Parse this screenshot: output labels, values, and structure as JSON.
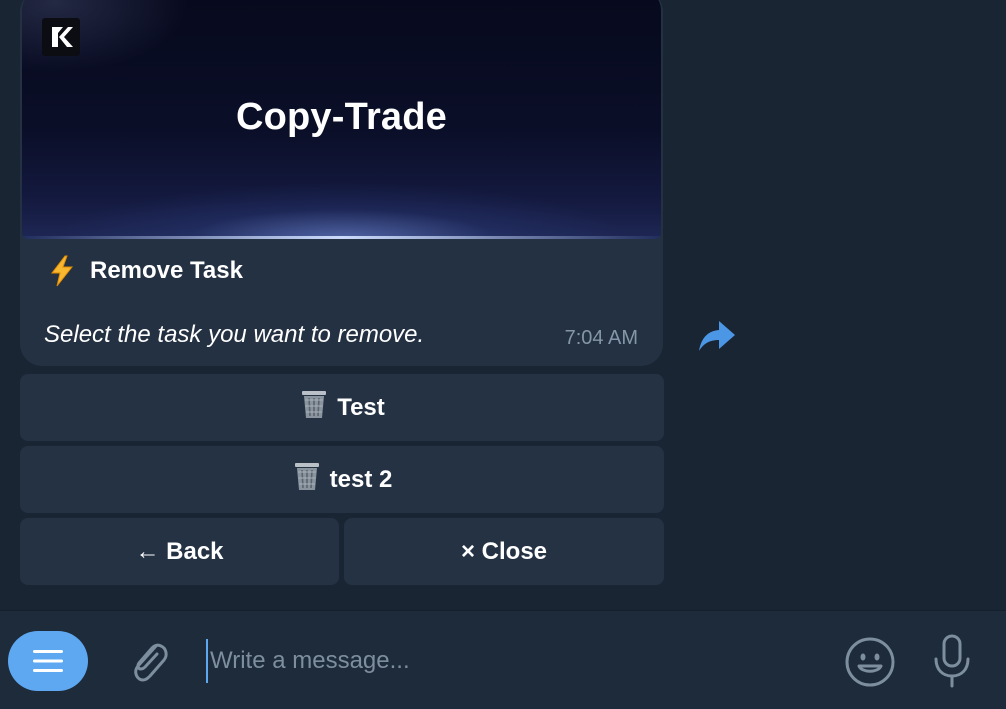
{
  "message": {
    "banner_title": "Copy-Trade",
    "heading": "Remove Task",
    "heading_icon": "lightning-icon",
    "subtitle": "Select the task you want to remove.",
    "time": "7:04 AM"
  },
  "keyboard": {
    "task_buttons": [
      {
        "label": "Test",
        "icon": "trash-icon"
      },
      {
        "label": "test 2",
        "icon": "trash-icon"
      }
    ],
    "back_label": "← Back",
    "close_label": "× Close"
  },
  "composer": {
    "placeholder": "Write a message..."
  },
  "colors": {
    "accent": "#5ea8f2",
    "background": "#1a2533",
    "bubble": "#233142",
    "button": "#243244"
  }
}
